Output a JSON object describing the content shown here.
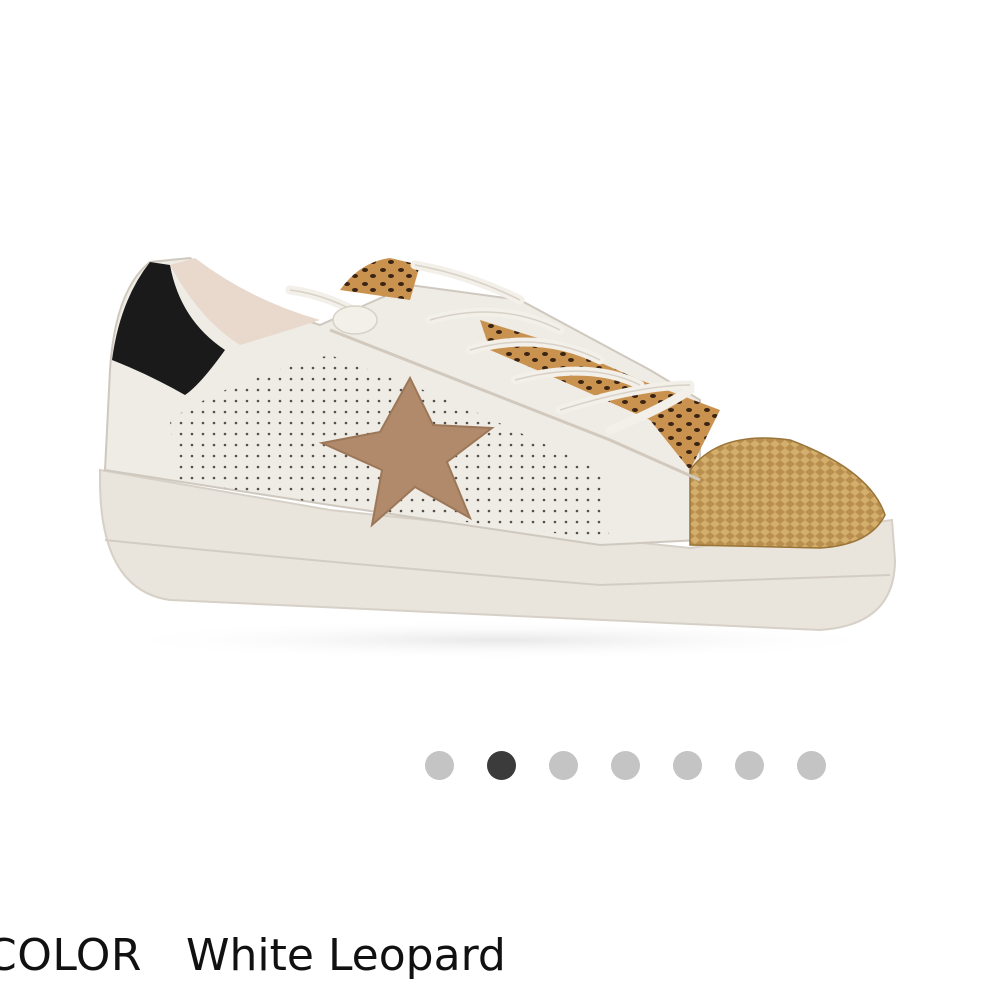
{
  "product": {
    "image_alt": "White Leopard sneaker",
    "image_colors": {
      "upper": "#ece7e0",
      "sole": "#e9e4dc",
      "heel_tab": "#1a1a1a",
      "star": "#b08a6a",
      "toe_cap": "#b38a4a",
      "leopard": "#a66a3a"
    }
  },
  "carousel": {
    "total": 7,
    "active_index": 1,
    "dot_color": "#c4c4c4",
    "active_dot_color": "#3b3b3b"
  },
  "color_selector": {
    "label": "COLOR",
    "value": "White Leopard"
  }
}
